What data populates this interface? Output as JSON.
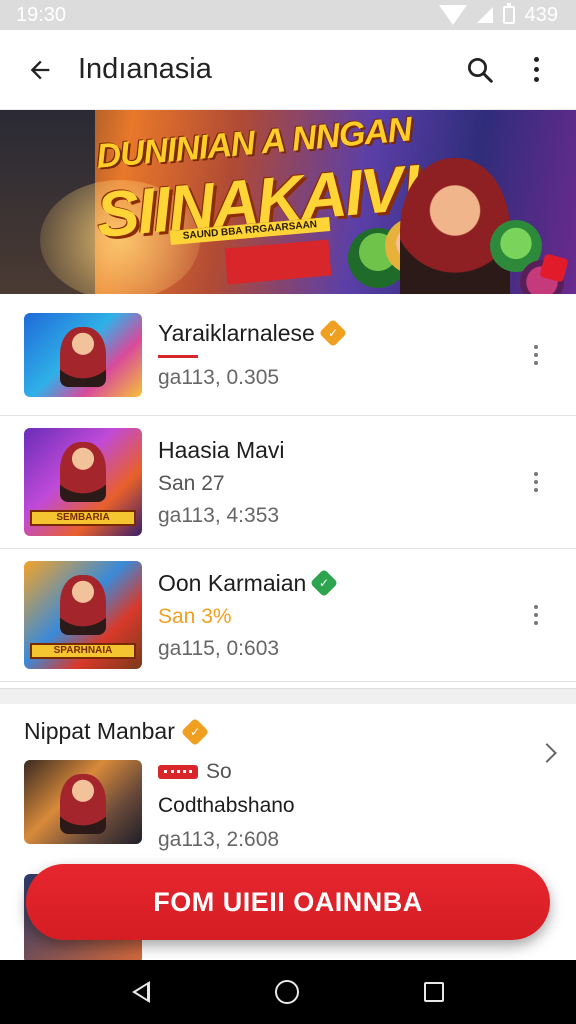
{
  "status_bar": {
    "time": "19:30",
    "battery_text": "439"
  },
  "app_bar": {
    "title": "Indıanasia",
    "icons": [
      "back-arrow-icon",
      "search-icon",
      "more-vert-icon"
    ]
  },
  "banner": {
    "title_line1": "DUNINIAN A NNGAN",
    "title_line2": "SIINAKAIV!",
    "strip_text": "SAUND BBA RRGAARSAAN"
  },
  "list": [
    {
      "title": "Yaraiklarnalese",
      "badge": "orange-verified",
      "subtitle": "",
      "meta": "ga113, 0.305",
      "subtitle_style": "red-bar"
    },
    {
      "title": "Haasia Mavi",
      "badge": "",
      "subtitle": "San 27",
      "meta": "ga113, 4:353",
      "thumb_label": "SEMBARIA"
    },
    {
      "title": "Oon Karmaian",
      "badge": "green-verified",
      "subtitle": "San 3%",
      "meta": "ga115, 0:603",
      "thumb_label": "SPARHNAIA",
      "subtitle_color": "orange"
    }
  ],
  "section": {
    "title": "Nippat Manbar",
    "item": {
      "tag": "So",
      "title": "Codthabshano",
      "meta": "ga113, 2:608"
    }
  },
  "fab": {
    "label": "FOM UIEII OAINNBA"
  },
  "colors": {
    "accent_red": "#e21b2b",
    "verified_orange": "#f0a020",
    "verified_green": "#2ea44f"
  }
}
